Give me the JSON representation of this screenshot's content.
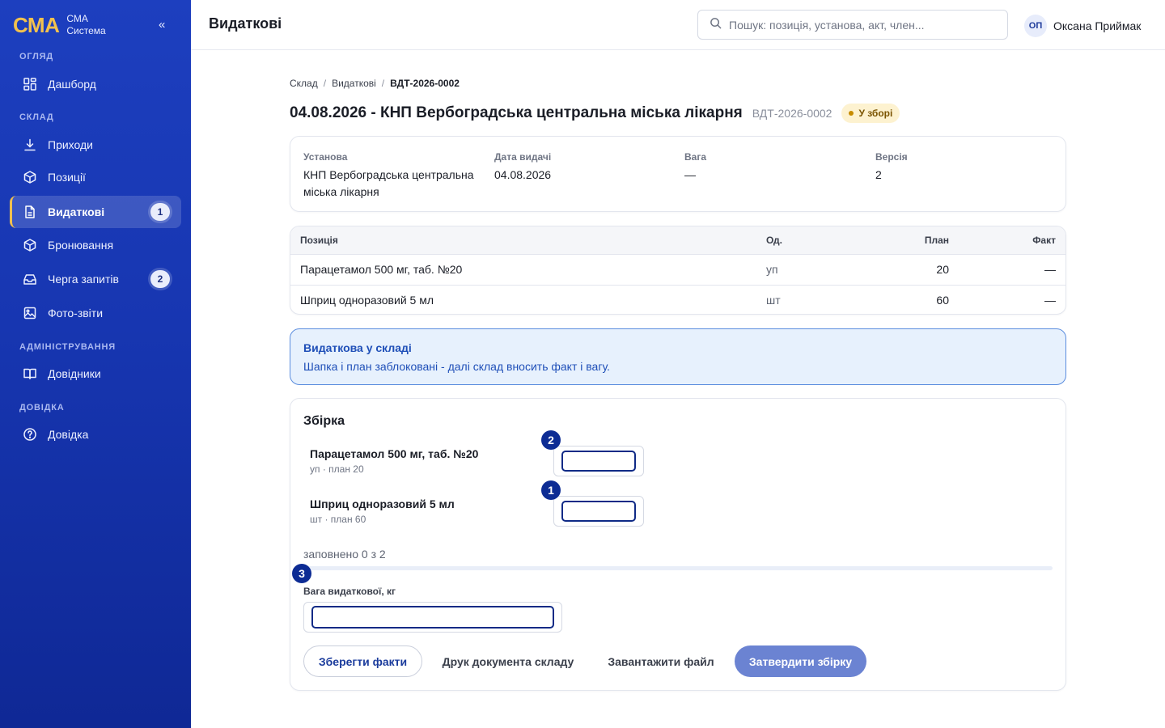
{
  "app": {
    "logo": "СМА",
    "name_line1": "СМА",
    "name_line2": "Система",
    "collapse_label": "«"
  },
  "sidebar": {
    "sections": [
      {
        "label": "ОГЛЯД"
      },
      {
        "label": "СКЛАД"
      },
      {
        "label": "АДМІНІСТРУВАННЯ"
      },
      {
        "label": "ДОВІДКА"
      }
    ],
    "items": [
      {
        "label": "Дашборд",
        "icon": "dashboard-icon"
      },
      {
        "label": "Приходи",
        "icon": "download-icon"
      },
      {
        "label": "Позиції",
        "icon": "box-icon"
      },
      {
        "label": "Видаткові",
        "icon": "document-icon",
        "badge": "1",
        "active": true
      },
      {
        "label": "Бронювання",
        "icon": "box-icon"
      },
      {
        "label": "Черга запитів",
        "icon": "inbox-icon",
        "badge": "2"
      },
      {
        "label": "Фото-звіти",
        "icon": "image-icon"
      },
      {
        "label": "Довідники",
        "icon": "book-icon"
      },
      {
        "label": "Довідка",
        "icon": "help-circle-icon"
      }
    ]
  },
  "header": {
    "title": "Видаткові",
    "search_placeholder": "Пошук: позиція, установа, акт, член...",
    "user_initials": "ОП",
    "user_name": "Оксана Приймак"
  },
  "breadcrumb": [
    "Склад",
    "Видаткові",
    "ВДТ-2026-0002"
  ],
  "document": {
    "title": "04.08.2026 - КНП Вербоградська центральна міська лікарня",
    "code": "ВДТ-2026-0002",
    "status": "У зборі",
    "info": [
      {
        "label": "Установа",
        "value": "КНП Вербоградська центральна міська лікарня"
      },
      {
        "label": "Дата видачі",
        "value": "04.08.2026"
      },
      {
        "label": "Вага",
        "value": "—"
      },
      {
        "label": "Версія",
        "value": "2"
      }
    ]
  },
  "table": {
    "headers": [
      "Позиція",
      "Од.",
      "План",
      "Факт"
    ],
    "rows": [
      {
        "name": "Парацетамол 500 мг, таб. №20",
        "unit": "уп",
        "plan": "20",
        "fact": "—"
      },
      {
        "name": "Шприц одноразовий 5 мл",
        "unit": "шт",
        "plan": "60",
        "fact": "—"
      }
    ]
  },
  "alert": {
    "title": "Видаткова у складі",
    "text": "Шапка і план заблоковані - далі склад вносить факт і вагу."
  },
  "assembly": {
    "title": "Збірка",
    "items": [
      {
        "name": "Парацетамол 500 мг, таб. №20",
        "sub": "уп · план 20",
        "marker": "2",
        "value": ""
      },
      {
        "name": "Шприц одноразовий 5 мл",
        "sub": "шт · план 60",
        "marker": "1",
        "value": ""
      }
    ],
    "progress_label": "заповнено 0 з 2",
    "progress_fraction": 0,
    "weight_marker": "3",
    "weight_label": "Вага видаткової, кг",
    "weight_value": "",
    "buttons": {
      "save": "Зберегти факти",
      "print": "Друк документа складу",
      "upload": "Завантажити файл",
      "confirm": "Затвердити збірку"
    }
  },
  "colors": {
    "sidebar_top": "#1d3fbf",
    "accent_yellow": "#f2c14e",
    "marker": "#0d2c94",
    "primary_button": "#6b83d2",
    "status_bg": "#fdf2d0"
  }
}
